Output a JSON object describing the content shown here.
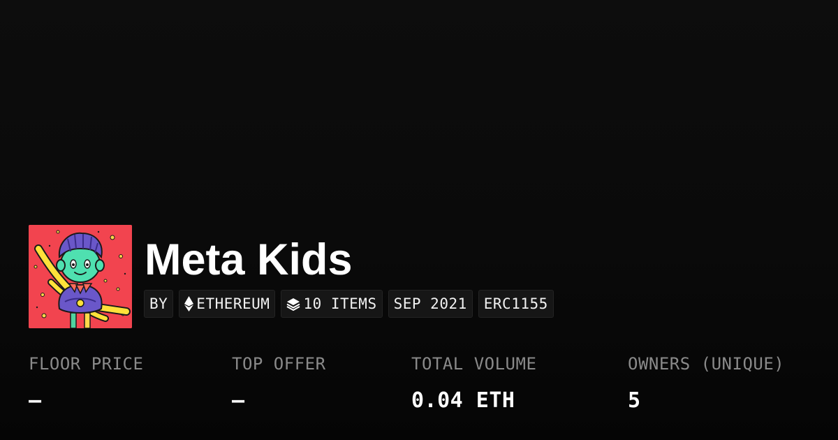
{
  "collection": {
    "name": "Meta Kids",
    "avatar_icon": "cartoon-kid-avatar",
    "avatar_bg": "#f2444f"
  },
  "tags": {
    "by": "BY",
    "chain": "ETHEREUM",
    "items": "10 ITEMS",
    "date": "SEP 2021",
    "standard": "ERC1155"
  },
  "stats": {
    "floor_price": {
      "label": "FLOOR PRICE",
      "value": "—"
    },
    "top_offer": {
      "label": "TOP OFFER",
      "value": "—"
    },
    "total_volume": {
      "label": "TOTAL VOLUME",
      "value": "0.04 ETH"
    },
    "owners": {
      "label": "OWNERS (UNIQUE)",
      "value": "5"
    }
  },
  "colors": {
    "background": "#0a0a0a",
    "tag_bg": "#161616",
    "label_gray": "#8a8a8a",
    "text": "#ffffff"
  }
}
